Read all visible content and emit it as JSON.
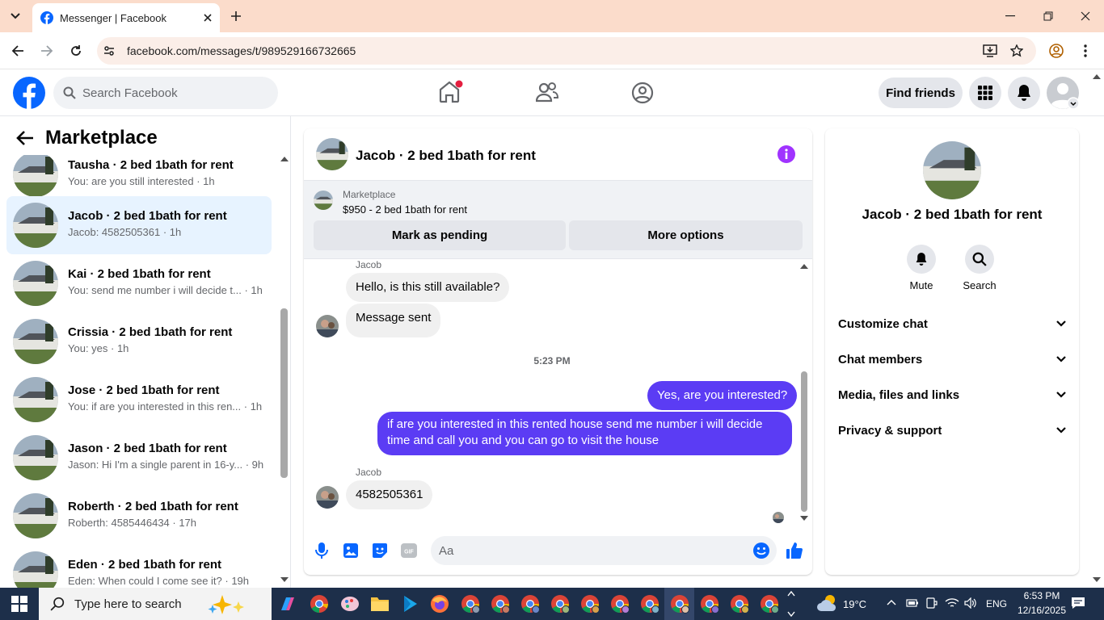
{
  "browser": {
    "tab_title": "Messenger | Facebook",
    "url": "facebook.com/messages/t/989529166732665"
  },
  "facebook": {
    "search_placeholder": "Search Facebook",
    "find_friends": "Find friends",
    "brand_color": "#0866ff"
  },
  "sidebar": {
    "title": "Marketplace",
    "conversations": [
      {
        "name": "Tausha · 2 bed 1bath for rent",
        "preview": "You: are you still interested · 1h"
      },
      {
        "name": "Jacob · 2 bed 1bath for rent",
        "preview": "Jacob: 4582505361 · 1h",
        "selected": true
      },
      {
        "name": "Kai · 2 bed 1bath for rent",
        "preview": "You: send me number i will decide t... · 1h"
      },
      {
        "name": "Crissia · 2 bed 1bath for rent",
        "preview": "You: yes · 1h"
      },
      {
        "name": "Jose · 2 bed 1bath for rent",
        "preview": "You: if are you interested in this ren... · 1h"
      },
      {
        "name": "Jason · 2 bed 1bath for rent",
        "preview": "Jason: Hi I'm a single parent in 16-y... · 9h"
      },
      {
        "name": "Roberth · 2 bed 1bath for rent",
        "preview": "Roberth: 4585446434 · 17h"
      },
      {
        "name": "Eden · 2 bed 1bath for rent",
        "preview": "Eden: When could I come see it? · 19h"
      }
    ]
  },
  "chat": {
    "title": "Jacob · 2 bed 1bath for rent",
    "marketplace_label": "Marketplace",
    "listing": "$950 - 2 bed 1bath for rent",
    "mark_pending": "Mark as pending",
    "more_options": "More options",
    "messages": {
      "sender1": "Jacob",
      "in1": "Hello, is this still available?",
      "in2": "Message sent",
      "timestamp": "5:23 PM",
      "out1": "Yes, are you interested?",
      "out2": "if are you interested in this rented house send me number i will decide time and call you and you can go to visit the house",
      "sender2": "Jacob",
      "in3": "4582505361"
    },
    "composer_placeholder": "Aa",
    "outgoing_color": "#5b3cf4"
  },
  "details": {
    "name": "Jacob · 2 bed 1bath for rent",
    "mute": "Mute",
    "search": "Search",
    "sections": [
      "Customize chat",
      "Chat members",
      "Media, files and links",
      "Privacy & support"
    ]
  },
  "taskbar": {
    "search_placeholder": "Type here to search",
    "weather": "19°C",
    "lang": "ENG",
    "time": "6:53 PM",
    "date": "12/16/2025"
  }
}
